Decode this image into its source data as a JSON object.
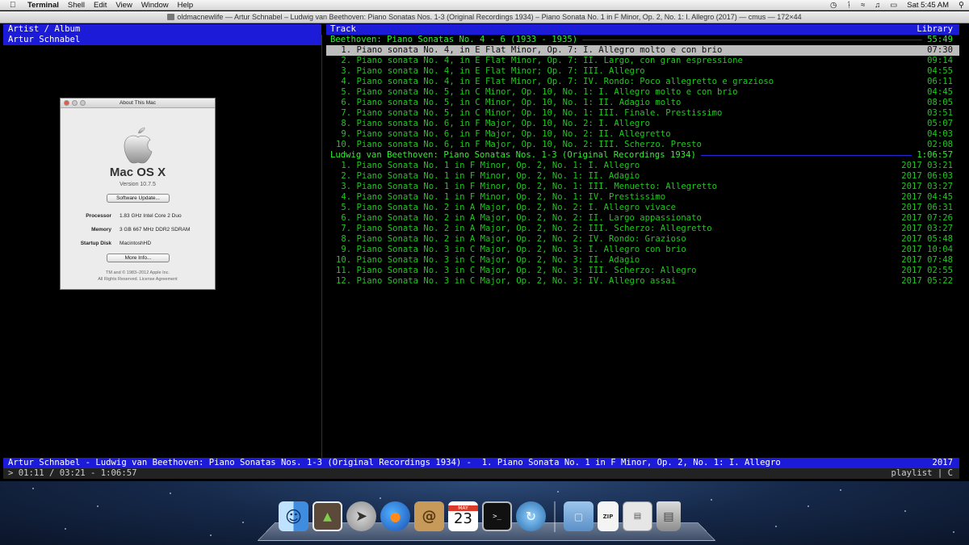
{
  "menubar": {
    "apple": "",
    "menus": [
      "Terminal",
      "Shell",
      "Edit",
      "View",
      "Window",
      "Help"
    ],
    "status": {
      "time": "Sat 5:45 AM"
    }
  },
  "window_title": "oldmacnewlife — Artur Schnabel – Ludwig van Beethoven: Piano Sonatas Nos. 1-3 (Original Recordings 1934) – Piano Sonata No. 1 in F Minor, Op. 2, No. 1: I. Allegro (2017) — cmus — 172×44",
  "cmus": {
    "left_header": "Artist / Album",
    "left_selected": "Artur Schnabel",
    "right_header": "Track",
    "right_header_view": "Library",
    "groups": [
      {
        "title": "Beethoven: Piano Sonatas No. 4 - 6 (1933 - 1935)",
        "duration": "55:49",
        "tracks": [
          {
            "title": " 1. Piano sonata No. 4, in E Flat Minor, Op. 7: I. Allegro molto e con brio",
            "year": "",
            "time": "07:30"
          },
          {
            "title": " 2. Piano sonata No. 4, in E Flat Minor, Op. 7: II. Largo, con gran espressione",
            "year": "",
            "time": "09:14"
          },
          {
            "title": " 3. Piano sonata No. 4, in E Flat Minor; Op. 7: III. Allegro",
            "year": "",
            "time": "04:55"
          },
          {
            "title": " 4. Piano sonata No. 4, in E Flat Minor, Op. 7: IV. Rondo: Poco allegretto e grazioso",
            "year": "",
            "time": "06:11"
          },
          {
            "title": " 5. Piano sonata No. 5, in C Minor, Op. 10, No. 1: I. Allegro molto e con brio",
            "year": "",
            "time": "04:45"
          },
          {
            "title": " 6. Piano sonata No. 5, in C Minor, Op. 10, No. 1: II. Adagio molto",
            "year": "",
            "time": "08:05"
          },
          {
            "title": " 7. Piano sonata No. 5, in C Minor, Op. 10, No. 1: III. Finale. Prestissimo",
            "year": "",
            "time": "03:51"
          },
          {
            "title": " 8. Piano sonata No. 6, in F Major, Op. 10, No. 2: I. Allegro",
            "year": "",
            "time": "05:07"
          },
          {
            "title": " 9. Piano sonata No. 6, in F Major, Op. 10, No. 2: II. Allegretto",
            "year": "",
            "time": "04:03"
          },
          {
            "title": "10. Piano sonata No. 6, in F Major, Op. 10, No. 2: III. Scherzo. Presto",
            "year": "",
            "time": "02:08"
          }
        ]
      },
      {
        "title": "Ludwig van Beethoven: Piano Sonatas Nos. 1-3 (Original Recordings 1934)",
        "duration": "1:06:57",
        "tracks": [
          {
            "title": " 1. Piano Sonata No. 1 in F Minor, Op. 2, No. 1: I. Allegro",
            "year": "2017",
            "time": "03:21"
          },
          {
            "title": " 2. Piano Sonata No. 1 in F Minor, Op. 2, No. 1: II. Adagio",
            "year": "2017",
            "time": "06:03"
          },
          {
            "title": " 3. Piano Sonata No. 1 in F Minor, Op. 2, No. 1: III. Menuetto: Allegretto",
            "year": "2017",
            "time": "03:27"
          },
          {
            "title": " 4. Piano Sonata No. 1 in F Minor, Op. 2, No. 1: IV. Prestissimo",
            "year": "2017",
            "time": "04:45"
          },
          {
            "title": " 5. Piano Sonata No. 2 in A Major, Op. 2, No. 2: I. Allegro vivace",
            "year": "2017",
            "time": "06:31"
          },
          {
            "title": " 6. Piano Sonata No. 2 in A Major, Op. 2, No. 2: II. Largo appassionato",
            "year": "2017",
            "time": "07:26"
          },
          {
            "title": " 7. Piano Sonata No. 2 in A Major, Op. 2, No. 2: III. Scherzo: Allegretto",
            "year": "2017",
            "time": "03:27"
          },
          {
            "title": " 8. Piano Sonata No. 2 in A Major, Op. 2, No. 2: IV. Rondo: Grazioso",
            "year": "2017",
            "time": "05:48"
          },
          {
            "title": " 9. Piano Sonata No. 3 in C Major, Op. 2, No. 3: I. Allegro con brio",
            "year": "2017",
            "time": "10:04"
          },
          {
            "title": "10. Piano Sonata No. 3 in C Major, Op. 2, No. 3: II. Adagio",
            "year": "2017",
            "time": "07:48"
          },
          {
            "title": "11. Piano Sonata No. 3 in C Major, Op. 2, No. 3: III. Scherzo: Allegro",
            "year": "2017",
            "time": "02:55"
          },
          {
            "title": "12. Piano Sonata No. 3 in C Major, Op. 2, No. 3: IV. Allegro assai",
            "year": "2017",
            "time": "05:22"
          }
        ]
      }
    ],
    "now_playing": "Artur Schnabel - Ludwig van Beethoven: Piano Sonatas Nos. 1-3 (Original Recordings 1934) -  1. Piano Sonata No. 1 in F Minor, Op. 2, No. 1: I. Allegro",
    "now_playing_year": "2017",
    "progress": "> 01:11 / 03:21 - 1:06:57",
    "mode": "playlist | C"
  },
  "about_mac": {
    "window_title": "About This Mac",
    "os_name": "Mac OS X",
    "version": "Version 10.7.5",
    "software_update": "Software Update...",
    "specs": [
      {
        "label": "Processor",
        "value": "1.83 GHz Intel Core 2 Duo"
      },
      {
        "label": "Memory",
        "value": "3 GB 667 MHz DDR2 SDRAM"
      },
      {
        "label": "Startup Disk",
        "value": "MacintoshHD"
      }
    ],
    "more_info": "More Info...",
    "footer_1": "TM and © 1983–2012 Apple Inc.",
    "footer_2": "All Rights Reserved.  License Agreement"
  },
  "dock": {
    "items": [
      "finder-icon",
      "preview-icon",
      "launchpad-icon",
      "firefox-icon",
      "contacts-icon",
      "calendar-icon",
      "terminal-icon",
      "time-machine-icon",
      "applications-folder-icon",
      "zip-archive-icon",
      "screenshot-icon",
      "trash-icon"
    ],
    "calendar_month": "MAY",
    "calendar_day": "23"
  },
  "colors": {
    "cmus_green": "#1fd31f",
    "cmus_blue_bar": "#1c1cd8",
    "selection_gray": "#bdbdbd"
  }
}
